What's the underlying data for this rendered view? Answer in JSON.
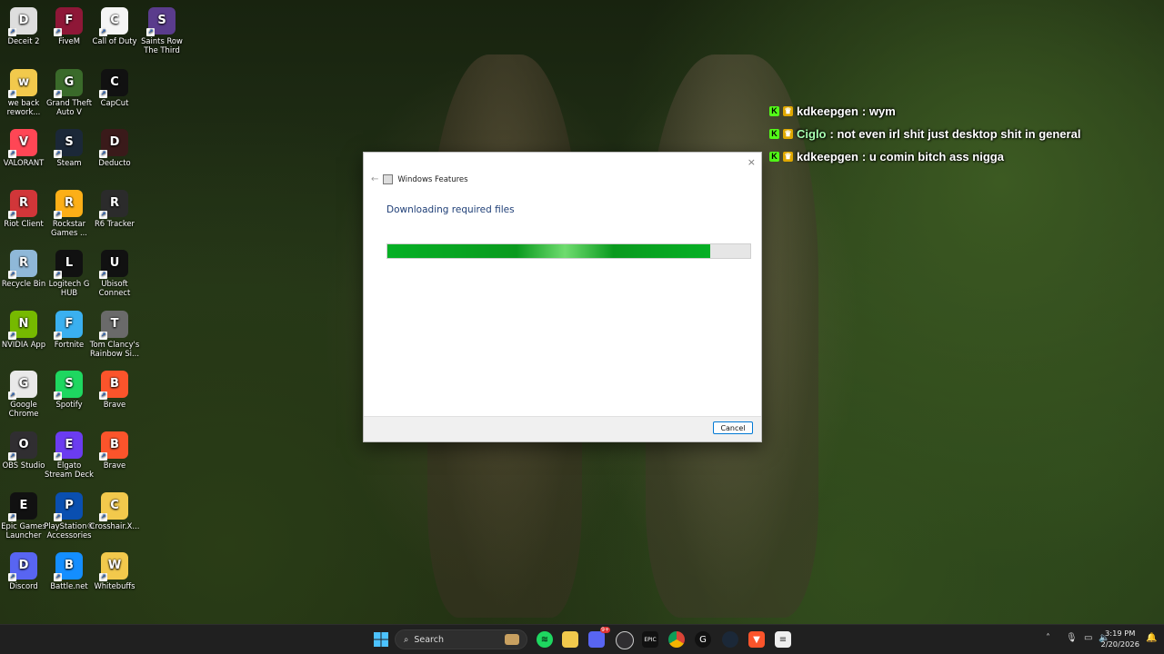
{
  "desktop": {
    "icons": [
      {
        "label": "Deceit 2",
        "icon": "deceit-icon",
        "color": "#dedede"
      },
      {
        "label": "FiveM",
        "icon": "fivem-icon",
        "color": "#8e1737"
      },
      {
        "label": "Call of Duty",
        "icon": "file-icon",
        "color": "#f5f5f5"
      },
      {
        "label": "Saints Row The Third",
        "icon": "saints-row-icon",
        "color": "#5a3c8c"
      },
      {
        "label": "we back rework...",
        "icon": "folder-icon",
        "color": "#f2c94c"
      },
      {
        "label": "Grand Theft Auto V",
        "icon": "gta-icon",
        "color": "#3a6a2a"
      },
      {
        "label": "CapCut",
        "icon": "capcut-icon",
        "color": "#111111"
      },
      {
        "label": "VALORANT",
        "icon": "valorant-icon",
        "color": "#ff4655"
      },
      {
        "label": "Steam",
        "icon": "steam-icon",
        "color": "#1b2838"
      },
      {
        "label": "Deducto",
        "icon": "deducto-icon",
        "color": "#3a1a1a"
      },
      {
        "label": "Riot Client",
        "icon": "riot-icon",
        "color": "#d13639"
      },
      {
        "label": "Rockstar Games ...",
        "icon": "rockstar-icon",
        "color": "#fcaf17"
      },
      {
        "label": "R6 Tracker",
        "icon": "r6-tracker-icon",
        "color": "#2b2b2b"
      },
      {
        "label": "Recycle Bin",
        "icon": "recycle-bin-icon",
        "color": "#8fb8d8"
      },
      {
        "label": "Logitech G HUB",
        "icon": "logitech-icon",
        "color": "#111111"
      },
      {
        "label": "Ubisoft Connect",
        "icon": "ubisoft-icon",
        "color": "#111111"
      },
      {
        "label": "NVIDIA App",
        "icon": "nvidia-icon",
        "color": "#76b900"
      },
      {
        "label": "Fortnite",
        "icon": "fortnite-icon",
        "color": "#3ab0f0"
      },
      {
        "label": "Tom Clancy's Rainbow Si...",
        "icon": "rainbow-six-icon",
        "color": "#6a6a6a"
      },
      {
        "label": "Google Chrome",
        "icon": "chrome-icon",
        "color": "#e9e9e9"
      },
      {
        "label": "Spotify",
        "icon": "spotify-icon",
        "color": "#1ed760"
      },
      {
        "label": "Brave",
        "icon": "brave-icon",
        "color": "#fb542b"
      },
      {
        "label": "OBS Studio",
        "icon": "obs-icon",
        "color": "#302e31"
      },
      {
        "label": "Elgato Stream Deck",
        "icon": "stream-deck-icon",
        "color": "#6b3cf0"
      },
      {
        "label": "Brave",
        "icon": "brave-icon",
        "color": "#fb542b"
      },
      {
        "label": "Epic Games Launcher",
        "icon": "epic-games-icon",
        "color": "#111111"
      },
      {
        "label": "PlayStation® Accessories",
        "icon": "playstation-icon",
        "color": "#0a4fb0"
      },
      {
        "label": "Crosshair.X...",
        "icon": "folder-icon",
        "color": "#f2c94c"
      },
      {
        "label": "Discord",
        "icon": "discord-icon",
        "color": "#5865f2"
      },
      {
        "label": "Battle.net",
        "icon": "battlenet-icon",
        "color": "#148eff"
      },
      {
        "label": "Whitebuffs",
        "icon": "folder-icon",
        "color": "#f2c94c"
      }
    ]
  },
  "chat": [
    {
      "user": "kdkeepgen",
      "message": ": wym",
      "user_color": "#ffffff"
    },
    {
      "user": "Ciglo",
      "message": ": not even irl shit just desktop shit in general",
      "user_color": "#a8ffb0"
    },
    {
      "user": "kdkeepgen",
      "message": ": u comin bitch ass nigga",
      "user_color": "#ffffff"
    }
  ],
  "dialog": {
    "title": "Windows Features",
    "heading": "Downloading required files",
    "progress_fraction": 0.89,
    "cancel_label": "Cancel",
    "close_glyph": "×",
    "back_glyph": "←"
  },
  "taskbar": {
    "search_placeholder": "Search",
    "time": "3:19 PM",
    "date": "2/20/2026",
    "apps": [
      "windows-start-icon",
      "spotify-icon",
      "file-explorer-icon",
      "discord-icon",
      "obs-icon",
      "epic-games-icon",
      "chrome-icon",
      "logitech-icon",
      "steam-icon",
      "brave-icon",
      "notepad-icon"
    ],
    "discord_badge": "9+"
  }
}
